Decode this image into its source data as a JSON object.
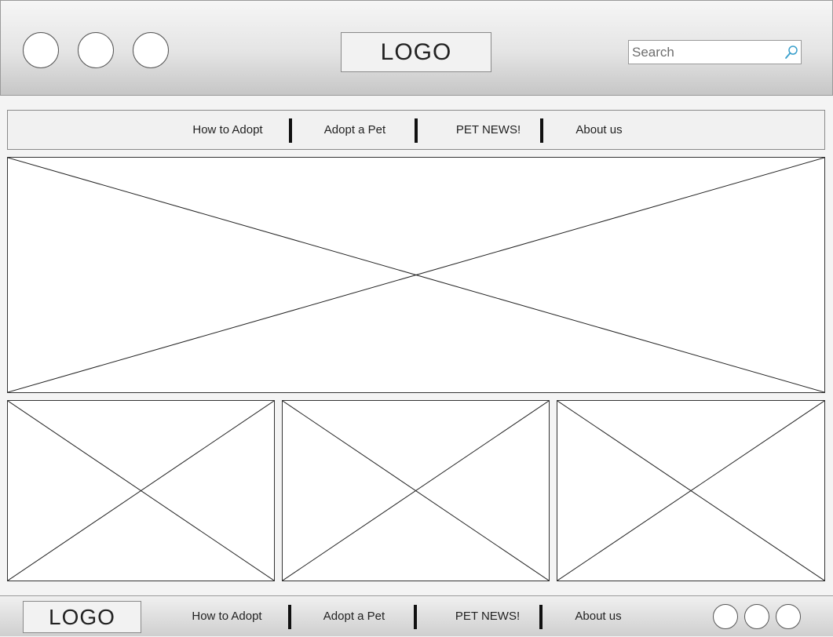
{
  "header": {
    "logo_text": "LOGO",
    "circle_buttons": [
      "circle-button",
      "circle-button",
      "circle-button"
    ],
    "search": {
      "placeholder": "Search",
      "value": "",
      "icon": "search-icon"
    }
  },
  "nav": {
    "items": [
      {
        "label": "How to Adopt"
      },
      {
        "label": "Adopt a Pet"
      },
      {
        "label": "PET NEWS!"
      },
      {
        "label": "About us"
      }
    ]
  },
  "content": {
    "hero_image": "image-placeholder",
    "tiles": [
      "image-placeholder",
      "image-placeholder",
      "image-placeholder"
    ]
  },
  "footer": {
    "logo_text": "LOGO",
    "links": [
      {
        "label": "How to Adopt"
      },
      {
        "label": "Adopt a Pet"
      },
      {
        "label": "PET NEWS!"
      },
      {
        "label": "About us"
      }
    ]
  },
  "colors": {
    "page_bg": "#f4f4f4",
    "header_gradient_top": "#f6f6f6",
    "header_gradient_bottom": "#c6c6c6",
    "search_icon": "#3aa0cc",
    "line": "#222222"
  }
}
